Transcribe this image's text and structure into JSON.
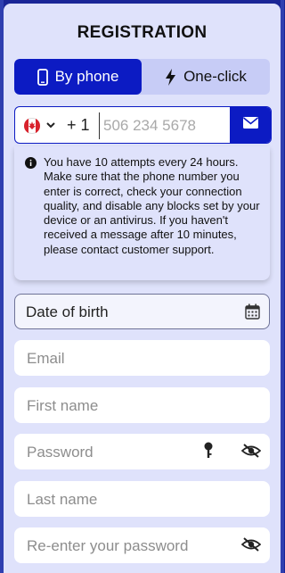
{
  "form": {
    "title": "REGISTRATION",
    "tabs": [
      {
        "label": "By phone",
        "icon": "smartphone-icon",
        "active": true
      },
      {
        "label": "One-click",
        "icon": "lightning-icon",
        "active": false
      }
    ],
    "phone": {
      "country_flag": "canada-flag-icon",
      "code": "+ 1",
      "placeholder": "506 234 5678",
      "send_icon": "envelope-icon"
    },
    "notice": "You have 10 attempts every 24 hours. Make sure that the phone number you enter is correct, check your connection quality, and disable any blocks set by your device or an antivirus. If you haven't received a message after 10 minutes, please contact customer support.",
    "fields": {
      "date_of_birth": "Date of birth",
      "email": "Email",
      "first_name": "First name",
      "password": "Password",
      "last_name": "Last name",
      "reenter_password": "Re-enter your password"
    }
  },
  "colors": {
    "accent": "#0c1bc3",
    "panel": "#dfe2fb",
    "background": "#1a2596"
  }
}
